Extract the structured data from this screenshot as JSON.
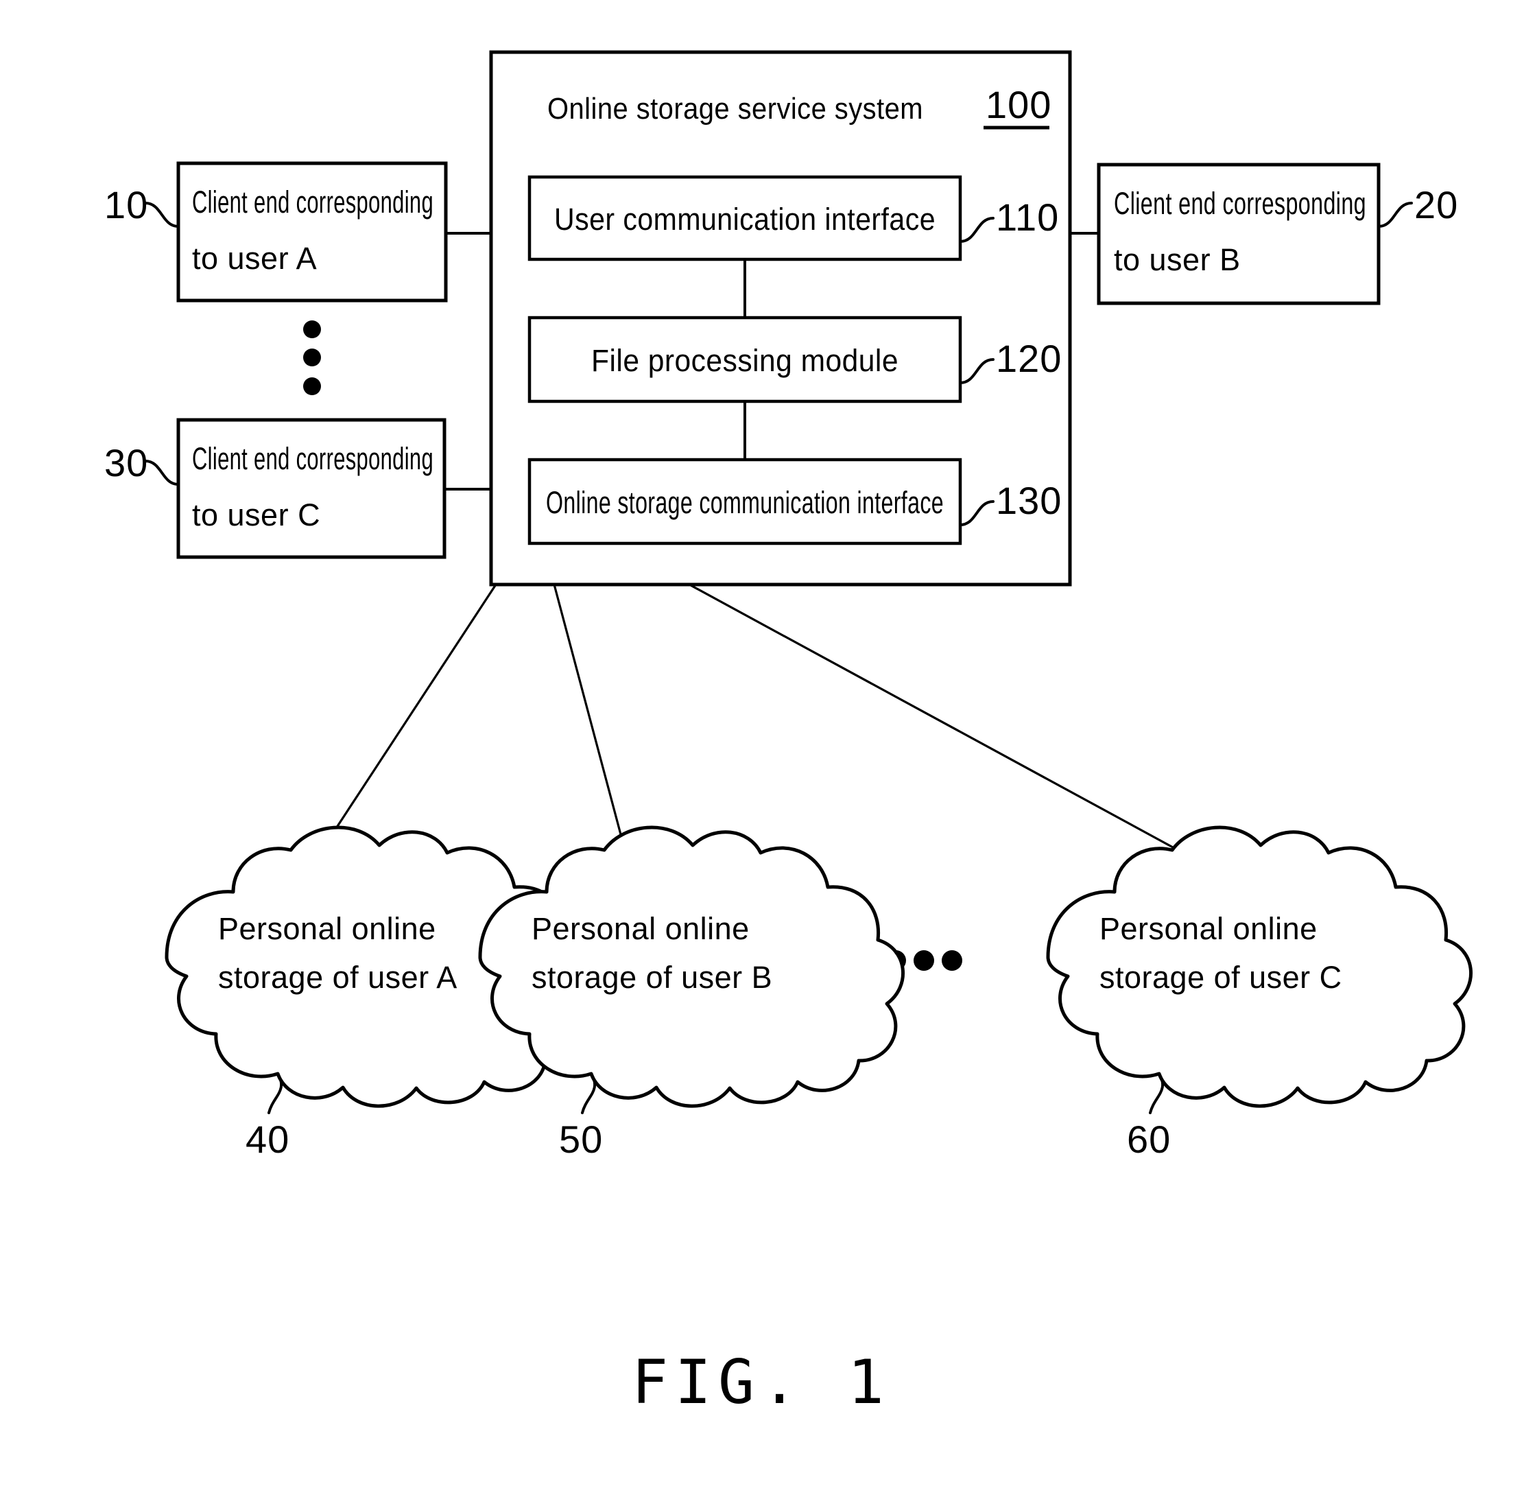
{
  "figure": {
    "caption": "FIG. 1",
    "title_text": "Online storage service system"
  },
  "system": {
    "label": "Online storage service system",
    "ref": "100",
    "modules": [
      {
        "label": "User communication interface",
        "ref": "110"
      },
      {
        "label": "File processing module",
        "ref": "120"
      },
      {
        "label": "Online storage communication interface",
        "ref": "130"
      }
    ]
  },
  "clients": [
    {
      "line1": "Client end corresponding",
      "line2": "to user A",
      "ref": "10",
      "side": "left"
    },
    {
      "line1": "Client end corresponding",
      "line2": "to user C",
      "ref": "30",
      "side": "left"
    },
    {
      "line1": "Client end corresponding",
      "line2": "to user B",
      "ref": "20",
      "side": "right"
    }
  ],
  "storages": [
    {
      "line1": "Personal online",
      "line2": "storage of user A",
      "ref": "40"
    },
    {
      "line1": "Personal online",
      "line2": "storage of user B",
      "ref": "50"
    },
    {
      "line1": "Personal online",
      "line2": "storage of user C",
      "ref": "60"
    }
  ],
  "ellipsis": {
    "vertical_dots": 3,
    "horizontal_dots": 4
  },
  "colors": {
    "ink": "#000000",
    "paper": "#ffffff"
  }
}
